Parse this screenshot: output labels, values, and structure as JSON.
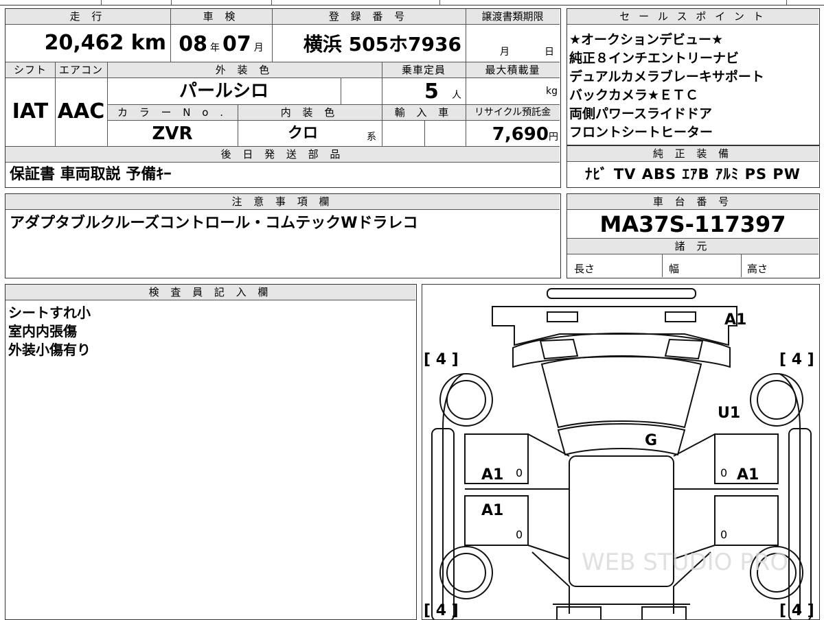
{
  "headers": {
    "mileage": "走 行",
    "inspection": "車 検",
    "registration": "登 録 番 号",
    "transfer_deadline": "譲渡書類期限",
    "sales_points": "セ ー ル ス ポ イ ン ト",
    "shift": "シフト",
    "aircon": "エアコン",
    "exterior_color": "外 装 色",
    "capacity": "乗車定員",
    "max_load": "最大積載量",
    "color_no": "カ ラ ー N o .",
    "interior_color": "内 装 色",
    "import": "輸 入 車",
    "recycle": "リサイクル預託金",
    "later_parts": "後 日 発 送 部 品",
    "genuine_equipment": "純 正 装 備",
    "caution": "注 意 事 項 欄",
    "chassis_number": "車 台 番 号",
    "specs": "諸 元",
    "inspector": "検 査 員 記 入 欄"
  },
  "values": {
    "mileage": "20,462 km",
    "inspection_year": "08",
    "inspection_year_unit": "年",
    "inspection_month": "07",
    "inspection_month_unit": "月",
    "registration": "横浜 505ホ7936",
    "deadline_month_unit": "月",
    "deadline_day_unit": "日",
    "shift": "IAT",
    "aircon": "AAC",
    "exterior_color": "パールシロ",
    "capacity": "5",
    "capacity_unit": "人",
    "max_load_unit": "kg",
    "color_no": "ZVR",
    "interior_color": "クロ",
    "interior_suffix": "系",
    "recycle": "7,690",
    "recycle_unit": "円",
    "later_parts": "保証書 車両取説 予備ｷｰ",
    "genuine_equipment": "ﾅﾋﾞ TV ABS ｴｱB ｱﾙﾐ PS PW",
    "caution": "アダプタブルクルーズコントロール・コムテックWドラレコ",
    "chassis_number": "MA37S-117397",
    "length_label": "長さ",
    "width_label": "幅",
    "height_label": "高さ"
  },
  "sales_points": [
    "★オークションデビュー★",
    "純正８インチエントリーナビ",
    "デュアルカメラブレーキサポート",
    "バックカメラ★ＥＴＣ",
    "両側パワースライドドア",
    "フロントシートヒーター"
  ],
  "inspector_notes": [
    "シートすれ小",
    "室内内張傷",
    "外装小傷有り"
  ],
  "diagram": {
    "tire_front_left": "[ 4 ]",
    "tire_front_right": "[ 4 ]",
    "tire_rear_left": "[ 4 ]",
    "tire_rear_right": "[ 4 ]",
    "mark_front_bumper": "A1",
    "mark_right_fender": "U1",
    "mark_windshield": "G",
    "mark_left_front_door": "A1",
    "mark_right_front_door": "A1",
    "mark_left_rear_door": "A1",
    "mark_zero": "0",
    "watermark": "WEB STUDIO PRO"
  }
}
